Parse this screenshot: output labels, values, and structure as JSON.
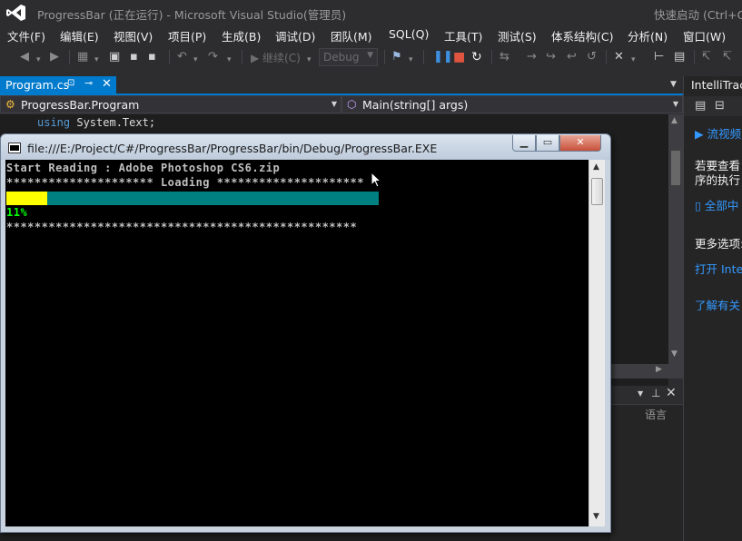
{
  "window": {
    "title": "ProgressBar (正在运行) - Microsoft Visual Studio(管理员)",
    "quick_launch": "快速启动 (Ctrl+Q)"
  },
  "menu": [
    "文件(F)",
    "编辑(E)",
    "视图(V)",
    "项目(P)",
    "生成(B)",
    "调试(D)",
    "团队(M)",
    "SQL(Q)",
    "工具(T)",
    "测试(S)",
    "体系结构(C)",
    "分析(N)",
    "窗口(W)"
  ],
  "toolbar": {
    "continue_label": "继续(C)",
    "configuration": "Debug"
  },
  "document_tab": {
    "label": "Program.cs"
  },
  "navigation": {
    "type_combo": "ProgressBar.Program",
    "member_combo": "Main(string[] args)"
  },
  "editor": {
    "keyword": "using",
    "code": " System.Text;"
  },
  "bottom_panel": {
    "column_header": "语言"
  },
  "right_panel": {
    "title": "IntelliTrace",
    "lines": [
      {
        "text": "流视频",
        "kind": "link"
      },
      {
        "text": "若要查看 I",
        "kind": "plain"
      },
      {
        "text": "序的执行",
        "kind": "plain"
      },
      {
        "text": "全部中",
        "kind": "link"
      },
      {
        "text": "更多选项:",
        "kind": "plain"
      },
      {
        "text": "打开 Intel",
        "kind": "link"
      },
      {
        "text": "了解有关",
        "kind": "link"
      }
    ]
  },
  "console": {
    "title": "file:///E:/Project/C#/ProgressBar/ProgressBar/bin/Debug/ProgressBar.EXE",
    "reading_line": "Start Reading : Adobe Photoshop CS6.zip",
    "loading_line": "********************* Loading *********************",
    "progress": 0.11,
    "percent_text": "11%",
    "footer_line": "**************************************************",
    "colors": {
      "track": "#008080",
      "fill": "#ffff00",
      "percent": "#00ff00"
    }
  }
}
